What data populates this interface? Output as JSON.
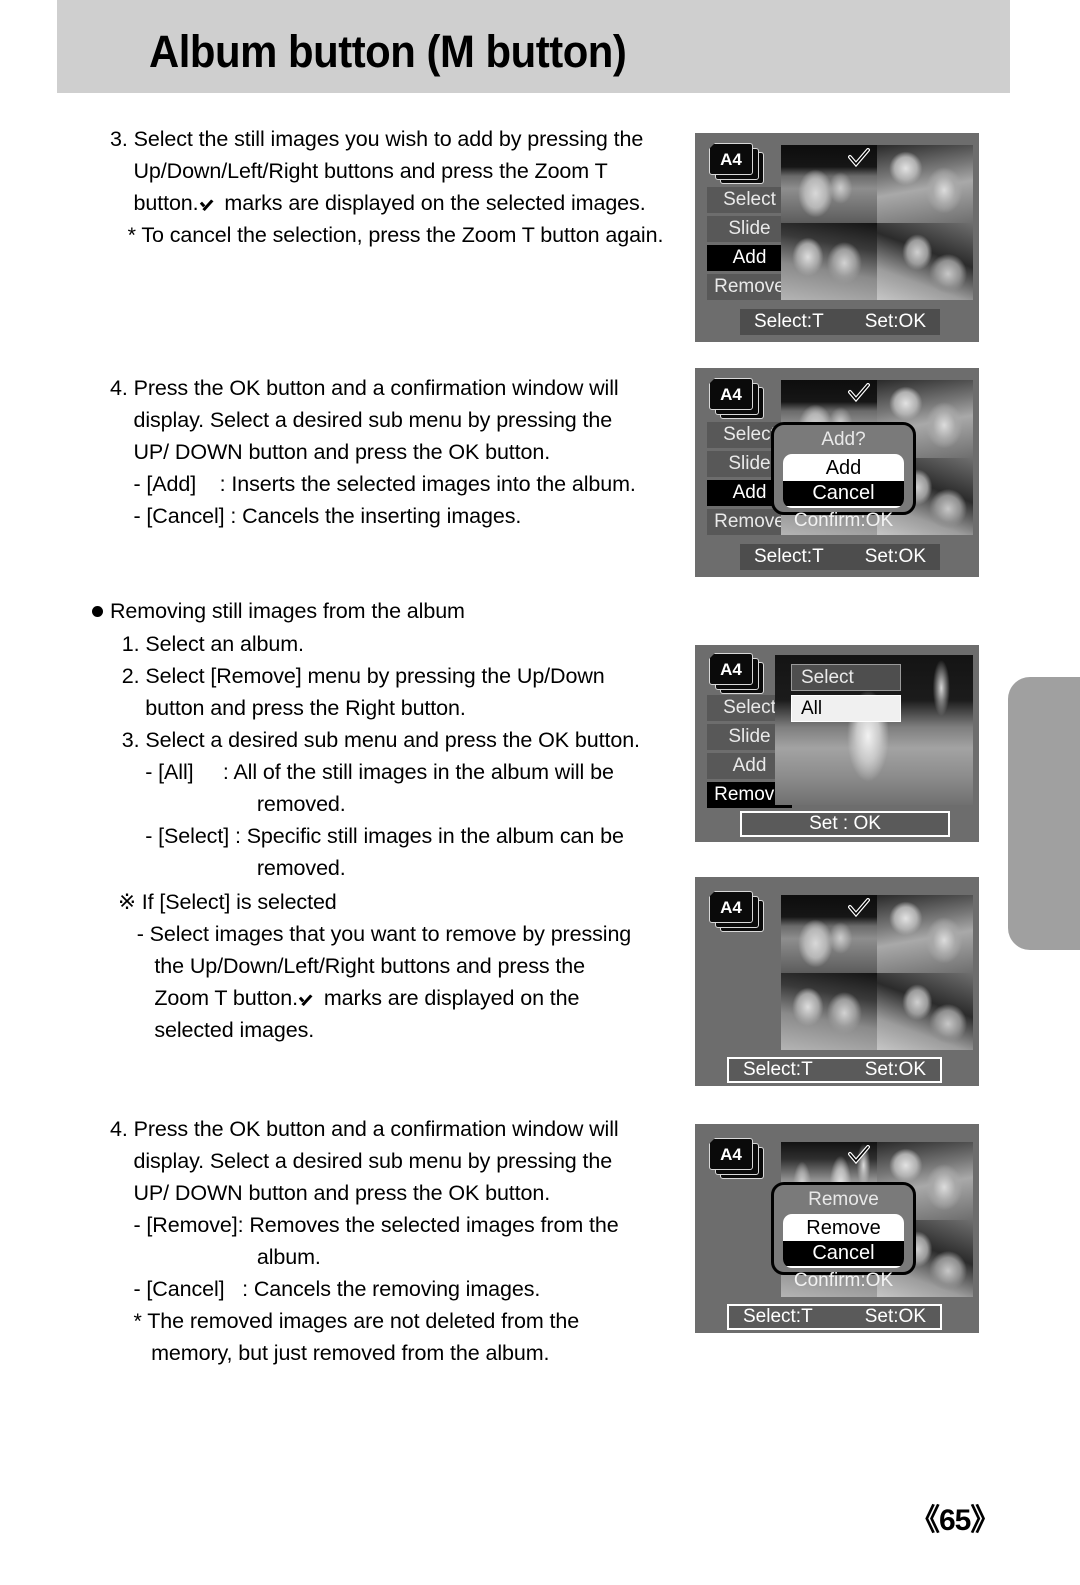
{
  "header": {
    "title": "Album button (M button)"
  },
  "page_number": "《65》",
  "body": {
    "step3": [
      "3. Select the still images you wish to add by pressing the",
      "    Up/Down/Left/Right buttons and press the Zoom T",
      "    button.",
      " marks are displayed on the selected images.",
      "   * To cancel the selection, press the Zoom T button again."
    ],
    "step4_add": [
      "4. Press the OK button and a confirmation window will",
      "    display. Select a desired sub menu by pressing the",
      "    UP/ DOWN button and press the OK button.",
      "    - [Add]    : Inserts the selected images into the album.",
      "    - [Cancel] : Cancels the inserting images."
    ],
    "removing_heading": "Removing still images from the album",
    "removing_steps": [
      "  1. Select an album.",
      "  2. Select [Remove] menu by pressing the Up/Down",
      "      button and press the Right button.",
      "  3. Select a desired sub menu and press the OK button.",
      "      - [All]     : All of the still images in the album will be",
      "                         removed.",
      "      - [Select] : Specific still images in the album can be",
      "                         removed."
    ],
    "if_select_note": "※ If [Select] is selected",
    "select_detail": [
      "  - Select images that you want to remove by pressing",
      "     the Up/Down/Left/Right buttons and press the",
      "     Zoom T button.",
      " marks are displayed on the",
      "     selected images."
    ],
    "step4_remove": [
      "4. Press the OK button and a confirmation window will",
      "    display. Select a desired sub menu by pressing the",
      "    UP/ DOWN button and press the OK button.",
      "    - [Remove]: Removes the selected images from the",
      "                         album.",
      "    - [Cancel]   : Cancels the removing images.",
      "    * The removed images are not deleted from the",
      "       memory, but just removed from the album."
    ]
  },
  "lcd_panels": [
    {
      "id": "panel-add-select",
      "album_label": "A4",
      "menu": [
        {
          "label": "Select",
          "active": false
        },
        {
          "label": "Slide",
          "active": false
        },
        {
          "label": "Add",
          "active": true
        },
        {
          "label": "Remove",
          "active": false
        }
      ],
      "status_left": "Select:T",
      "status_right": "Set:OK"
    },
    {
      "id": "panel-add-confirm",
      "album_label": "A4",
      "menu": [
        {
          "label": "Select",
          "active": false
        },
        {
          "label": "Slide",
          "active": false
        },
        {
          "label": "Add",
          "active": true
        },
        {
          "label": "Remove",
          "active": false
        }
      ],
      "dialog": {
        "title": "Add?",
        "options": [
          {
            "label": "Add",
            "selected": false
          },
          {
            "label": "Cancel",
            "selected": true
          }
        ],
        "footer": "Confirm:OK"
      },
      "status_left": "Select:T",
      "status_right": "Set:OK"
    },
    {
      "id": "panel-remove-submenu",
      "album_label": "A4",
      "menu": [
        {
          "label": "Select",
          "active": false
        },
        {
          "label": "Slide",
          "active": false
        },
        {
          "label": "Add",
          "active": false
        },
        {
          "label": "Remove",
          "active": true
        }
      ],
      "submenu": [
        {
          "label": "Select",
          "highlighted": false
        },
        {
          "label": "All",
          "highlighted": true
        }
      ],
      "status_center": "Set : OK"
    },
    {
      "id": "panel-remove-select",
      "album_label": "A4",
      "status_left": "Select:T",
      "status_right": "Set:OK"
    },
    {
      "id": "panel-remove-confirm",
      "album_label": "A4",
      "dialog": {
        "title": "Remove",
        "options": [
          {
            "label": "Remove",
            "selected": false
          },
          {
            "label": "Cancel",
            "selected": true
          }
        ],
        "footer": "Confirm:OK"
      },
      "status_left": "Select:T",
      "status_right": "Set:OK"
    }
  ],
  "colors": {
    "banner": "#cfcfcf",
    "lcd_bg": "#6d6d6d",
    "menu_bg": "#585858",
    "menu_active": "#000000",
    "side_tab": "#a0a0a0"
  }
}
